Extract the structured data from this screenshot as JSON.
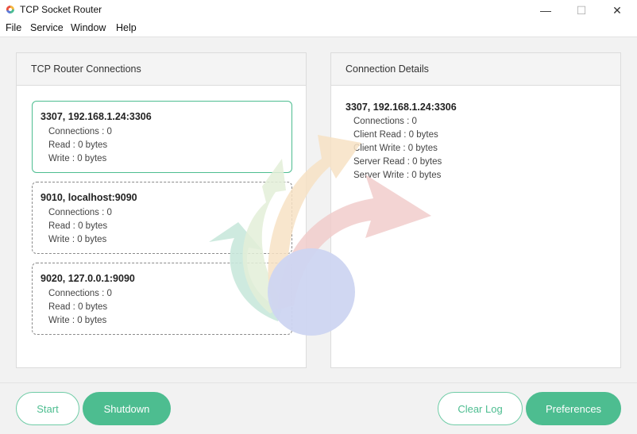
{
  "window": {
    "title": "TCP Socket Router",
    "controls": {
      "minimize": "—",
      "maximize": "☐",
      "close": "✕"
    }
  },
  "menu": [
    "File",
    "Service",
    "Window",
    "Help"
  ],
  "left_panel": {
    "title": "TCP Router Connections",
    "connections": [
      {
        "title": "3307, 192.168.1.24:3306",
        "connections": "Connections : 0",
        "read": "Read : 0 bytes",
        "write": "Write : 0 bytes"
      },
      {
        "title": "9010, localhost:9090",
        "connections": "Connections : 0",
        "read": "Read : 0 bytes",
        "write": "Write : 0 bytes"
      },
      {
        "title": "9020, 127.0.0.1:9090",
        "connections": "Connections : 0",
        "read": "Read : 0 bytes",
        "write": "Write : 0 bytes"
      }
    ]
  },
  "right_panel": {
    "title": "Connection Details",
    "detail": {
      "title": "3307, 192.168.1.24:3306",
      "lines": [
        "Connections : 0",
        "Client Read : 0 bytes",
        "Client Write : 0 bytes",
        "Server Read : 0 bytes",
        "Server Write : 0 bytes"
      ]
    }
  },
  "buttons": {
    "start": "Start",
    "shutdown": "Shutdown",
    "clear_log": "Clear Log",
    "preferences": "Preferences"
  },
  "colors": {
    "accent": "#4dbd90",
    "arrow_green": "#c9e8dc",
    "arrow_lightgreen": "#e3eed8",
    "arrow_peach": "#f7e2c4",
    "arrow_pink": "#f1cdcb",
    "circle_blue": "#cdd5f1"
  }
}
